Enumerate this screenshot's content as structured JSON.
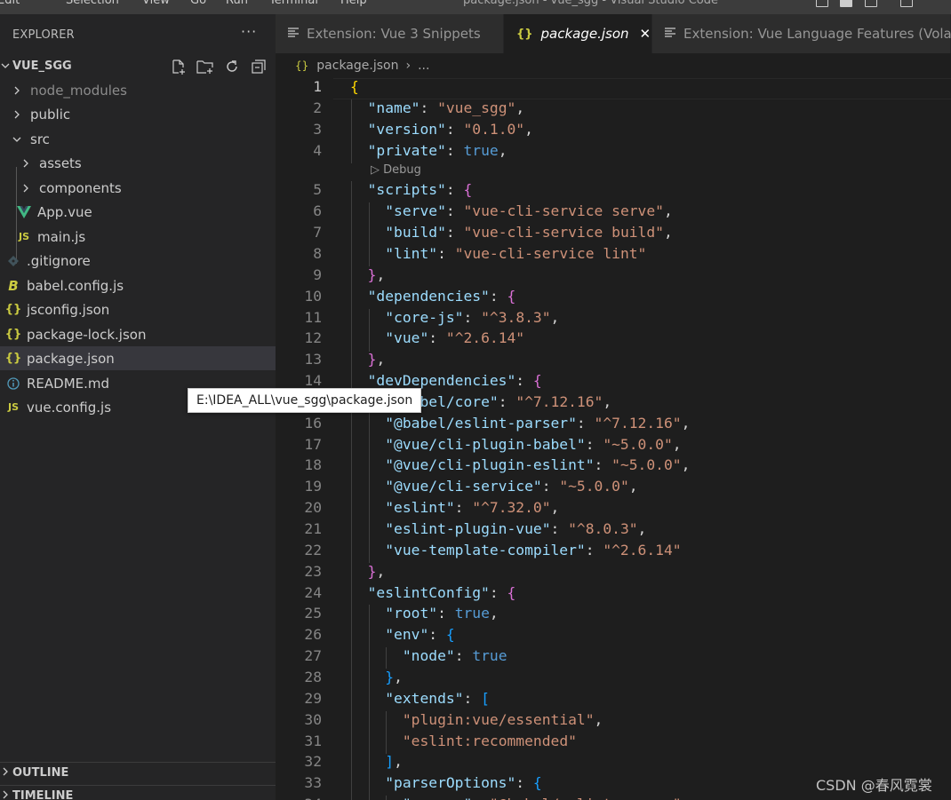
{
  "titlebar": {
    "menu": [
      "Edit",
      "Selection",
      "View",
      "Go",
      "Run",
      "Terminal",
      "Help"
    ],
    "window_title": "package.json - vue_sgg - Visual Studio Code"
  },
  "explorer": {
    "title": "EXPLORER",
    "more_label": "···",
    "root_folder": "VUE_SGG",
    "items": [
      {
        "label": "node_modules",
        "icon": "chevron-right-icon",
        "type": "folder",
        "depth": 0
      },
      {
        "label": "public",
        "icon": "chevron-right-icon",
        "type": "folder",
        "depth": 0
      },
      {
        "label": "src",
        "icon": "chevron-down-icon",
        "type": "folder",
        "depth": 0
      },
      {
        "label": "assets",
        "icon": "chevron-right-icon",
        "type": "folder",
        "depth": 1
      },
      {
        "label": "components",
        "icon": "chevron-right-icon",
        "type": "folder",
        "depth": 1
      },
      {
        "label": "App.vue",
        "icon": "vue-icon",
        "type": "file",
        "depth": 1
      },
      {
        "label": "main.js",
        "icon": "js-icon",
        "type": "file",
        "depth": 1
      },
      {
        "label": ".gitignore",
        "icon": "git-icon",
        "type": "file",
        "depth": 0
      },
      {
        "label": "babel.config.js",
        "icon": "babel-icon",
        "type": "file",
        "depth": 0
      },
      {
        "label": "jsconfig.json",
        "icon": "json-icon",
        "type": "file",
        "depth": 0
      },
      {
        "label": "package-lock.json",
        "icon": "json-icon",
        "type": "file",
        "depth": 0
      },
      {
        "label": "package.json",
        "icon": "json-icon",
        "type": "file",
        "depth": 0
      },
      {
        "label": "README.md",
        "icon": "info-icon",
        "type": "file",
        "depth": 0
      },
      {
        "label": "vue.config.js",
        "icon": "js-icon",
        "type": "file",
        "depth": 0
      }
    ],
    "selected_item": "package.json",
    "outline_label": "OUTLINE",
    "timeline_label": "TIMELINE"
  },
  "tooltip": "E:\\IDEA_ALL\\vue_sgg\\package.json",
  "tabs": [
    {
      "label": "Extension: Vue 3 Snippets",
      "icon": "extension-doc-icon",
      "active": false
    },
    {
      "label": "package.json",
      "icon": "json-icon",
      "active": true
    },
    {
      "label": "Extension: Vue Language Features (Volar)",
      "icon": "extension-doc-icon",
      "active": false
    }
  ],
  "breadcrumb": {
    "file": "package.json",
    "rest": "..."
  },
  "codelens": "Debug",
  "code_lines": [
    "{",
    "  \"name\": \"vue_sgg\",",
    "  \"version\": \"0.1.0\",",
    "  \"private\": true,",
    "  \"scripts\": {",
    "    \"serve\": \"vue-cli-service serve\",",
    "    \"build\": \"vue-cli-service build\",",
    "    \"lint\": \"vue-cli-service lint\"",
    "  },",
    "  \"dependencies\": {",
    "    \"core-js\": \"^3.8.3\",",
    "    \"vue\": \"^2.6.14\"",
    "  },",
    "  \"devDependencies\": {",
    "    \"@babel/core\": \"^7.12.16\",",
    "    \"@babel/eslint-parser\": \"^7.12.16\",",
    "    \"@vue/cli-plugin-babel\": \"~5.0.0\",",
    "    \"@vue/cli-plugin-eslint\": \"~5.0.0\",",
    "    \"@vue/cli-service\": \"~5.0.0\",",
    "    \"eslint\": \"^7.32.0\",",
    "    \"eslint-plugin-vue\": \"^8.0.3\",",
    "    \"vue-template-compiler\": \"^2.6.14\"",
    "  },",
    "  \"eslintConfig\": {",
    "    \"root\": true,",
    "    \"env\": {",
    "      \"node\": true",
    "    },",
    "    \"extends\": [",
    "      \"plugin:vue/essential\",",
    "      \"eslint:recommended\"",
    "    ],",
    "    \"parserOptions\": {",
    "      \"parser\": \"@babel/eslint-parser\""
  ],
  "watermark": "CSDN @春风霓裳",
  "colors": {
    "key": "#9cdcfe",
    "string": "#ce9178",
    "boolean": "#569cd6",
    "bracket_level1": "#ffd700",
    "bracket_level2": "#da70d6",
    "bracket_level3": "#179fff",
    "selected_row": "#37373d",
    "sidebar_bg": "#252526",
    "editor_bg": "#1e1e1e"
  }
}
